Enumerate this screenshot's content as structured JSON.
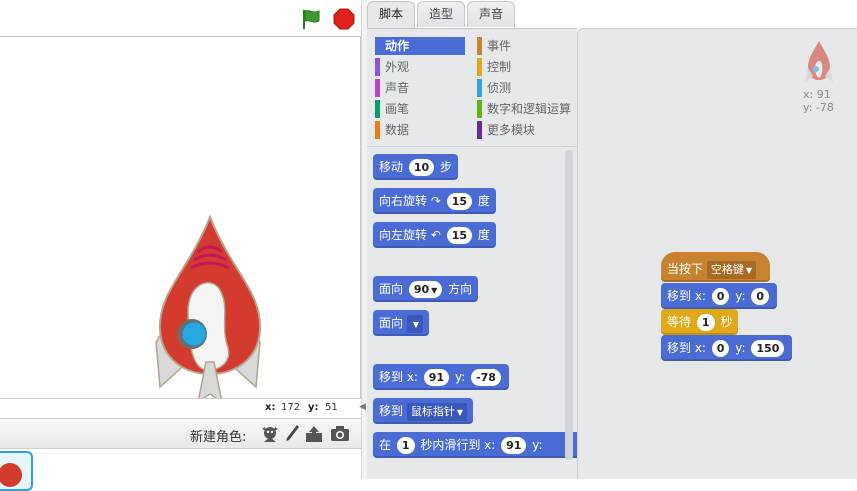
{
  "stage": {
    "mouse_x_label": "x:",
    "mouse_x": "172",
    "mouse_y_label": "y:",
    "mouse_y": "51"
  },
  "sprites": {
    "new_sprite_label": "新建角色:"
  },
  "tabs": [
    {
      "label": "脚本"
    },
    {
      "label": "造型"
    },
    {
      "label": "声音"
    }
  ],
  "categories": [
    {
      "label": "动作",
      "color": "#4a6cd4"
    },
    {
      "label": "外观",
      "color": "#8a55d7"
    },
    {
      "label": "声音",
      "color": "#bb42c3"
    },
    {
      "label": "画笔",
      "color": "#0e9a6c"
    },
    {
      "label": "数据",
      "color": "#ee7d16"
    },
    {
      "label": "事件",
      "color": "#c88330"
    },
    {
      "label": "控制",
      "color": "#e1a91a"
    },
    {
      "label": "侦测",
      "color": "#2ca5e2"
    },
    {
      "label": "数字和逻辑运算",
      "color": "#5cb712"
    },
    {
      "label": "更多模块",
      "color": "#632d99"
    }
  ],
  "palette": {
    "move": {
      "text": "移动",
      "value": "10",
      "suffix": "步"
    },
    "turn_right": {
      "text": "向右旋转",
      "value": "15",
      "suffix": "度"
    },
    "turn_left": {
      "text": "向左旋转",
      "value": "15",
      "suffix": "度"
    },
    "point_dir": {
      "text": "面向",
      "value": "90",
      "suffix": "方向"
    },
    "point_towards": {
      "text": "面向"
    },
    "goto_xy": {
      "text": "移到 x:",
      "x": "91",
      "ylabel": "y:",
      "y": "-78"
    },
    "goto": {
      "text": "移到",
      "value": "鼠标指针"
    },
    "glide": {
      "text": "在",
      "secs": "1",
      "mid": "秒内滑行到 x:",
      "x": "91",
      "ylabel": "y:"
    }
  },
  "script": {
    "hat": {
      "text": "当按下",
      "key": "空格键"
    },
    "goto1": {
      "text": "移到 x:",
      "x": "0",
      "ylabel": "y:",
      "y": "0"
    },
    "wait": {
      "text": "等待",
      "value": "1",
      "suffix": "秒"
    },
    "goto2": {
      "text": "移到 x:",
      "x": "0",
      "ylabel": "y:",
      "y": "150"
    }
  },
  "sprite_info": {
    "x": "x: 91",
    "y": "y: -78"
  },
  "colors": {
    "motion": "#4a6cd4",
    "events": "#c88330",
    "control": "#e1a91a",
    "flag": "#3d9a2c",
    "stop": "#e0201d"
  },
  "icons": [
    "green-flag-icon",
    "stop-icon",
    "sprite-library-icon",
    "paint-icon",
    "upload-icon",
    "camera-icon"
  ]
}
